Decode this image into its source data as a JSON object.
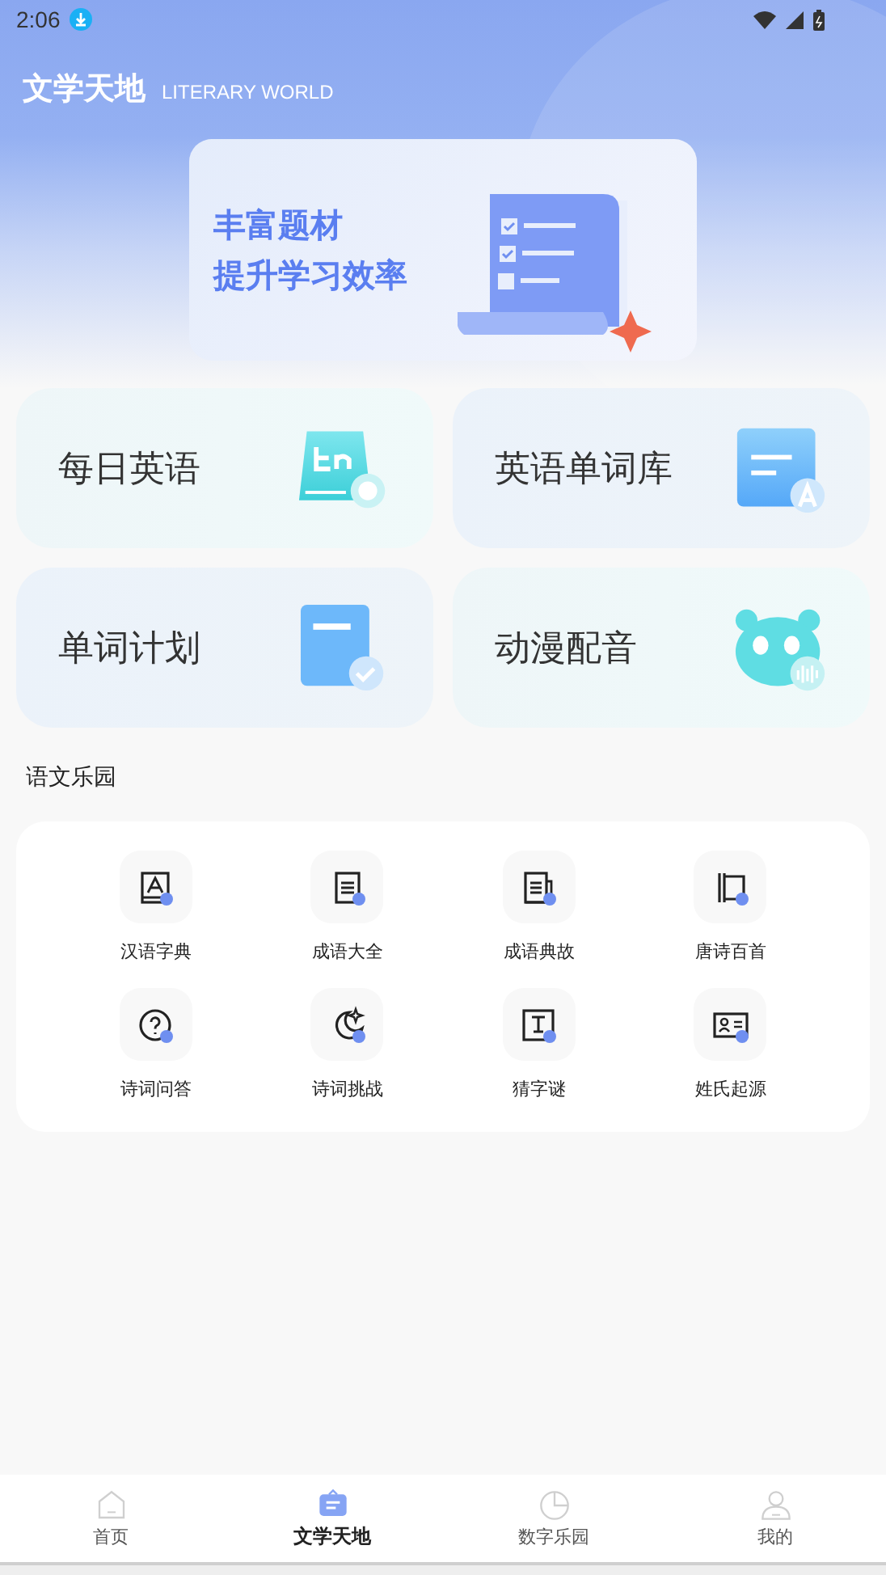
{
  "status_bar": {
    "time": "2:06"
  },
  "header": {
    "title": "文学天地",
    "subtitle": "LITERARY WORLD"
  },
  "banner": {
    "lines": [
      "丰富题材",
      "提升学习效率"
    ]
  },
  "features": [
    {
      "label": "每日英语",
      "kind": "book"
    },
    {
      "label": "英语单词库",
      "kind": "wordbank"
    },
    {
      "label": "单词计划",
      "kind": "plan"
    },
    {
      "label": "动漫配音",
      "kind": "panda"
    }
  ],
  "section": {
    "title": "语文乐园"
  },
  "tools": [
    {
      "label": "汉语字典",
      "kind": "dictionary"
    },
    {
      "label": "成语大全",
      "kind": "document"
    },
    {
      "label": "成语典故",
      "kind": "documents"
    },
    {
      "label": "唐诗百首",
      "kind": "scroll"
    },
    {
      "label": "诗词问答",
      "kind": "question"
    },
    {
      "label": "诗词挑战",
      "kind": "moon"
    },
    {
      "label": "猜字谜",
      "kind": "text"
    },
    {
      "label": "姓氏起源",
      "kind": "idcard"
    }
  ],
  "bottom_nav": [
    {
      "label": "首页",
      "kind": "home",
      "selected": false
    },
    {
      "label": "文学天地",
      "kind": "literature",
      "selected": true
    },
    {
      "label": "数字乐园",
      "kind": "chart",
      "selected": false
    },
    {
      "label": "我的",
      "kind": "profile",
      "selected": false
    }
  ]
}
